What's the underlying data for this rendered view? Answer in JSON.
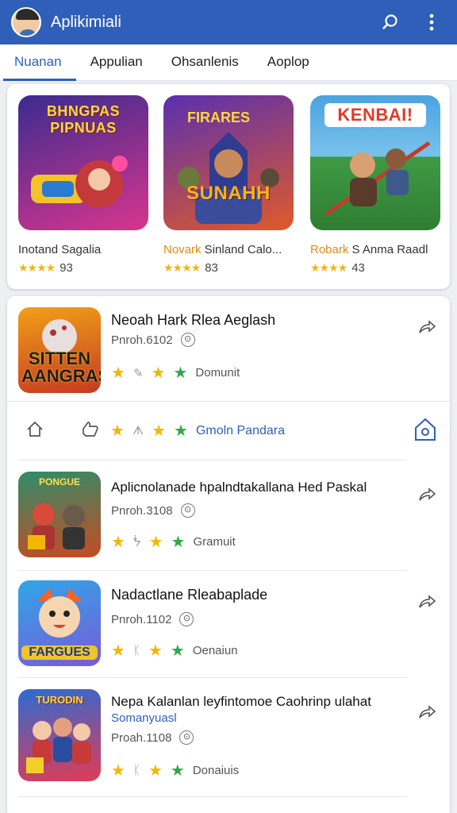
{
  "app_bar": {
    "title": "Aplikimiali",
    "icons": [
      "avatar",
      "search-icon",
      "more-vert-icon"
    ]
  },
  "tabs": [
    {
      "label": "Nuanan",
      "active": true
    },
    {
      "label": "Appulian",
      "active": false
    },
    {
      "label": "Ohsanlenis",
      "active": false
    },
    {
      "label": "Aoplop",
      "active": false
    }
  ],
  "featured": [
    {
      "art_text": "BHNGPAS PIPNUAS",
      "name": "Inotand Sagalia",
      "rating": "93",
      "colors": [
        "#3b2b8f",
        "#d8358d"
      ]
    },
    {
      "art_text": "SUNAHH",
      "name": "Novark Sinland Calo...",
      "name_highlight": "Novark",
      "rating": "83",
      "colors": [
        "#5a2fb0",
        "#e05a2a"
      ]
    },
    {
      "art_text": "KENBAI!",
      "name": "Robark S Anma Raadl",
      "name_highlight": "Robark",
      "rating": "43",
      "colors": [
        "#4aa3e0",
        "#3f9a45"
      ]
    }
  ],
  "list": [
    {
      "title": "Neoah Hark Rlea Aeglash",
      "meta": "Pnroh.6102",
      "price": "Domunit",
      "icon_text": "SITTEN AANGRAS",
      "colors": [
        "#f0a018",
        "#c63a22"
      ]
    },
    {
      "title": "Aplicnolanade hpalndtakallana Hed Paskal",
      "meta": "Pnroh.3108",
      "price": "Gramuit",
      "icon_text": "PONGUE",
      "colors": [
        "#2f8d6a",
        "#c84a22"
      ]
    },
    {
      "title": "Nadactlane Rleabaplade",
      "meta": "Pnroh.1102",
      "price": "Oenaiun",
      "icon_text": "FARGUES",
      "colors": [
        "#2fa6e8",
        "#f1c32c"
      ]
    },
    {
      "title": "Nepa Kalanlan leyfintomoe Caohrinp ulahat",
      "subtitle": "Somanyuasl",
      "meta": "Proah.1108",
      "price": "Donaiuis",
      "icon_text": "TURODIN",
      "colors": [
        "#2c6bd2",
        "#e23b55"
      ]
    }
  ],
  "action_bar": {
    "link": "Gmoln Pandara"
  },
  "colors": {
    "accent": "#2f5fb8",
    "star": "#f2b705",
    "green_star": "#2ea84a"
  }
}
